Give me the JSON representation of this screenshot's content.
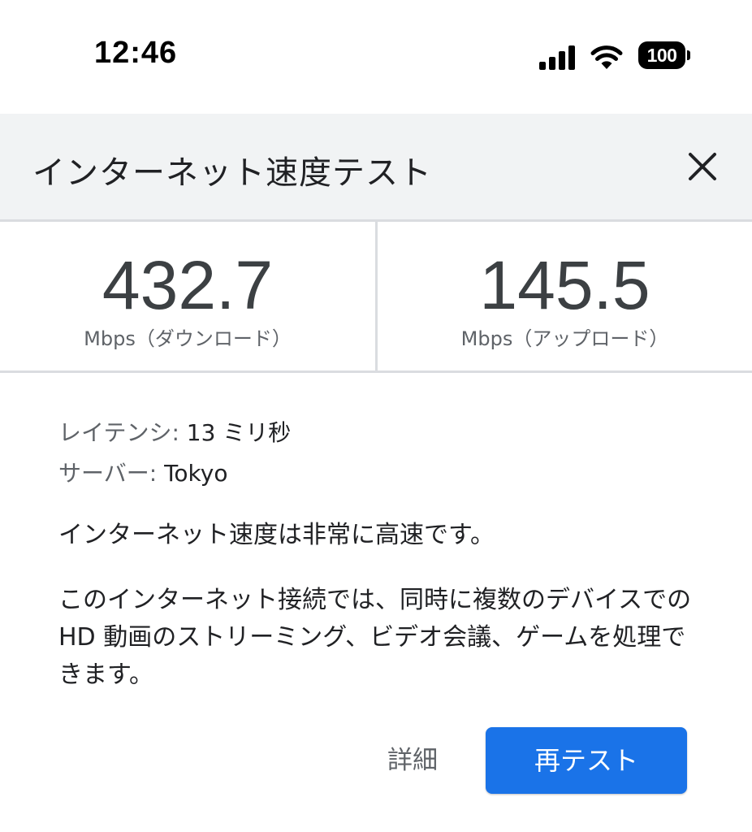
{
  "status_bar": {
    "time": "12:46",
    "battery_level": "100",
    "icons": [
      "signal-icon",
      "wifi-icon",
      "battery-icon"
    ]
  },
  "dialog": {
    "title": "インターネット速度テスト",
    "close_icon": "close-icon"
  },
  "download": {
    "value": "432.7",
    "unit": "Mbps（ダウンロード）"
  },
  "upload": {
    "value": "145.5",
    "unit": "Mbps（アップロード）"
  },
  "details": {
    "latency_label": "レイテンシ:",
    "latency_value": "13 ミリ秒",
    "server_label": "サーバー:",
    "server_value": "Tokyo"
  },
  "summary": "インターネット速度は非常に高速です。",
  "description": "このインターネット接続では、同時に複数のデバイスでの HD 動画のストリーミング、ビデオ会議、ゲームを処理できます。",
  "buttons": {
    "details_label": "詳細",
    "retest_label": "再テスト"
  },
  "colors": {
    "accent": "#1a73e8",
    "header_bg": "#f1f3f4",
    "divider": "#dadce0"
  }
}
